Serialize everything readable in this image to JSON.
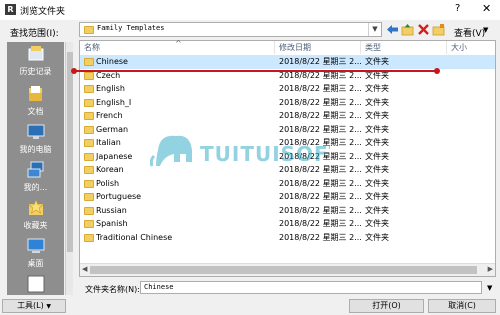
{
  "window": {
    "title": "浏览文件夹",
    "help": "?",
    "close": "✕"
  },
  "toolbar": {
    "look_in_label": "查找范围(I):",
    "look_in_value": "Family Templates",
    "view_label": "查看(V)"
  },
  "places": [
    {
      "label": "历史记录",
      "icon": "history-icon"
    },
    {
      "label": "文档",
      "icon": "documents-icon"
    },
    {
      "label": "我的电脑",
      "icon": "computer-icon"
    },
    {
      "label": "我的...",
      "icon": "network-icon"
    },
    {
      "label": "收藏夹",
      "icon": "favorites-icon"
    },
    {
      "label": "桌面",
      "icon": "desktop-icon"
    }
  ],
  "columns": [
    "名称",
    "修改日期",
    "类型",
    "大小"
  ],
  "files": [
    {
      "name": "Chinese",
      "date": "2018/8/22 星期三 2...",
      "type": "文件夹"
    },
    {
      "name": "Czech",
      "date": "2018/8/22 星期三 2...",
      "type": "文件夹"
    },
    {
      "name": "English",
      "date": "2018/8/22 星期三 2...",
      "type": "文件夹"
    },
    {
      "name": "English_I",
      "date": "2018/8/22 星期三 2...",
      "type": "文件夹"
    },
    {
      "name": "French",
      "date": "2018/8/22 星期三 2...",
      "type": "文件夹"
    },
    {
      "name": "German",
      "date": "2018/8/22 星期三 2...",
      "type": "文件夹"
    },
    {
      "name": "Italian",
      "date": "2018/8/22 星期三 2...",
      "type": "文件夹"
    },
    {
      "name": "Japanese",
      "date": "2018/8/22 星期三 2...",
      "type": "文件夹"
    },
    {
      "name": "Korean",
      "date": "2018/8/22 星期三 2...",
      "type": "文件夹"
    },
    {
      "name": "Polish",
      "date": "2018/8/22 星期三 2...",
      "type": "文件夹"
    },
    {
      "name": "Portuguese",
      "date": "2018/8/22 星期三 2...",
      "type": "文件夹"
    },
    {
      "name": "Russian",
      "date": "2018/8/22 星期三 2...",
      "type": "文件夹"
    },
    {
      "name": "Spanish",
      "date": "2018/8/22 星期三 2...",
      "type": "文件夹"
    },
    {
      "name": "Traditional Chinese",
      "date": "2018/8/22 星期三 2...",
      "type": "文件夹"
    }
  ],
  "selected_file": "Chinese",
  "footer": {
    "filename_label": "文件夹名称(N):",
    "filename_value": "Chinese",
    "tools_label": "工具(L)",
    "open_label": "打开(O)",
    "cancel_label": "取消(C)"
  },
  "watermark": {
    "text": "TUITUISOFT"
  },
  "colors": {
    "selection": "#cce8ff",
    "annotation": "#c9161b",
    "places_bg": "#8e8e8e",
    "folder": "#f3cf63"
  }
}
